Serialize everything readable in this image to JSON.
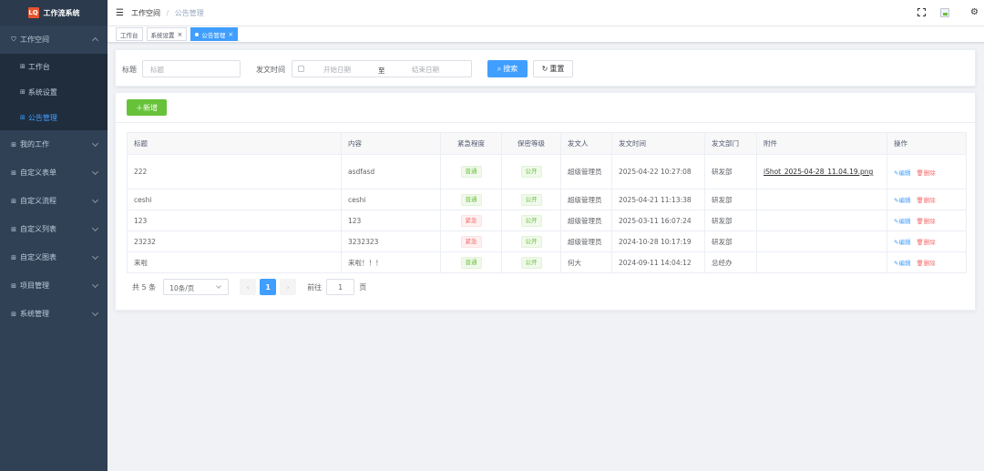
{
  "app": {
    "logo_mark": "LQ",
    "name": "工作流系统"
  },
  "sidebar": {
    "groups": [
      {
        "label": "工作空间",
        "icon": "shield-icon",
        "expanded": true,
        "items": [
          {
            "label": "工作台",
            "active": false
          },
          {
            "label": "系统设置",
            "active": false
          },
          {
            "label": "公告管理",
            "active": true
          }
        ]
      },
      {
        "label": "我的工作",
        "icon": "grid-icon",
        "expanded": false
      },
      {
        "label": "自定义表单",
        "icon": "grid-icon",
        "expanded": false
      },
      {
        "label": "自定义流程",
        "icon": "grid-icon",
        "expanded": false
      },
      {
        "label": "自定义列表",
        "icon": "grid-icon",
        "expanded": false
      },
      {
        "label": "自定义图表",
        "icon": "grid-icon",
        "expanded": false
      },
      {
        "label": "项目管理",
        "icon": "grid-icon",
        "expanded": false
      },
      {
        "label": "系统管理",
        "icon": "grid-icon",
        "expanded": false
      }
    ]
  },
  "navbar": {
    "breadcrumb": [
      "工作空间",
      "公告管理"
    ],
    "separator": "/"
  },
  "tags": [
    {
      "label": "工作台",
      "closable": false,
      "active": false
    },
    {
      "label": "系统设置",
      "closable": true,
      "active": false
    },
    {
      "label": "公告管理",
      "closable": true,
      "active": true
    }
  ],
  "search": {
    "title_label": "标题",
    "title_placeholder": "标题",
    "date_label": "发文时间",
    "start_placeholder": "开始日期",
    "range_separator": "至",
    "end_placeholder": "结束日期",
    "search_button": "搜索",
    "reset_button": "重置"
  },
  "toolbar": {
    "add_button": "新增"
  },
  "table": {
    "headers": [
      "标题",
      "内容",
      "紧急程度",
      "保密等级",
      "发文人",
      "发文时间",
      "发文部门",
      "附件",
      "操作"
    ],
    "rows": [
      {
        "title": "222",
        "content": "asdfasd",
        "urgency": "普通",
        "urgency_color": "green",
        "secrecy": "公开",
        "author": "超级管理员",
        "time": "2025-04-22 10:27:08",
        "dept": "研发部",
        "attachment": "iShot_2025-04-28_11.04.19.png"
      },
      {
        "title": "ceshi",
        "content": "ceshi",
        "urgency": "普通",
        "urgency_color": "green",
        "secrecy": "公开",
        "author": "超级管理员",
        "time": "2025-04-21 11:13:38",
        "dept": "研发部",
        "attachment": ""
      },
      {
        "title": "123",
        "content": "123",
        "urgency": "紧急",
        "urgency_color": "red",
        "secrecy": "公开",
        "author": "超级管理员",
        "time": "2025-03-11 16:07:24",
        "dept": "研发部",
        "attachment": ""
      },
      {
        "title": "23232",
        "content": "3232323",
        "urgency": "紧急",
        "urgency_color": "red",
        "secrecy": "公开",
        "author": "超级管理员",
        "time": "2024-10-28 10:17:19",
        "dept": "研发部",
        "attachment": ""
      },
      {
        "title": "来啦",
        "content": "来啦！！！",
        "urgency": "普通",
        "urgency_color": "green",
        "secrecy": "公开",
        "author": "何大",
        "time": "2024-09-11 14:04:12",
        "dept": "总经办",
        "attachment": ""
      }
    ],
    "edit_label": "编辑",
    "delete_label": "删除"
  },
  "pagination": {
    "total_text": "共 5 条",
    "page_size": "10条/页",
    "current_page": "1",
    "jump_label": "前往",
    "jump_value": "1",
    "page_unit": "页"
  },
  "colors": {
    "sidebar_bg": "#304156",
    "primary": "#409eff",
    "success": "#67c23a",
    "danger": "#f56c6c"
  }
}
